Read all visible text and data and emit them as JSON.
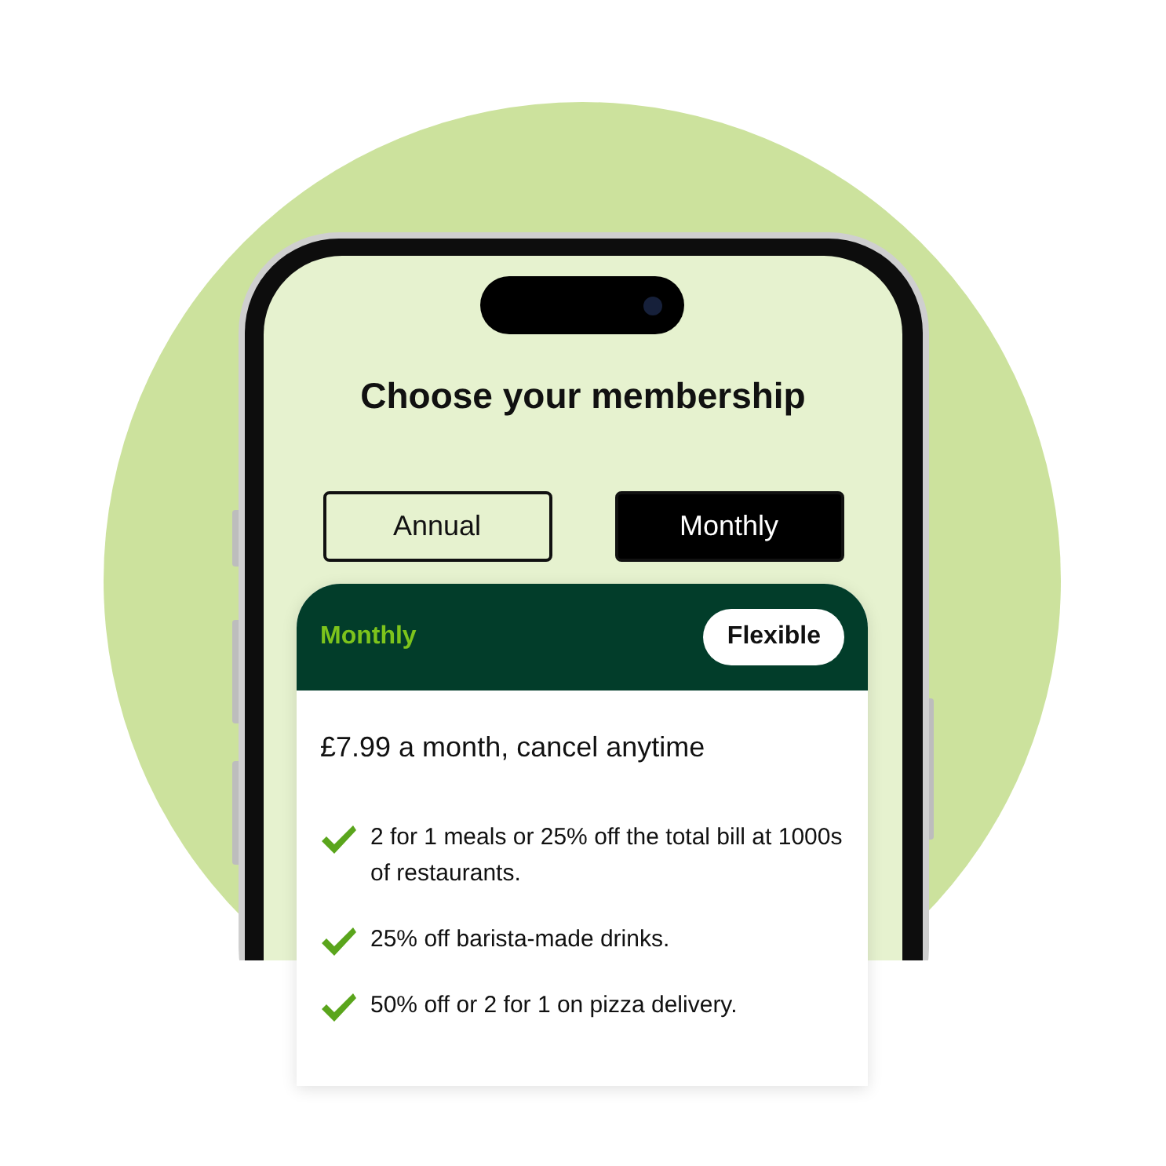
{
  "title": "Choose your membership",
  "plan_options": [
    {
      "label": "Annual",
      "selected": false
    },
    {
      "label": "Monthly",
      "selected": true
    }
  ],
  "plan_card": {
    "name": "Monthly",
    "badge": "Flexible",
    "price": "£7.99 a month, cancel anytime",
    "benefits": [
      {
        "text": "2 for 1 meals or 25% off the total bill at 1000s of restaurants."
      },
      {
        "text": "25% off barista-made drinks."
      },
      {
        "text": "50% off or 2 for 1 on pizza delivery."
      }
    ]
  }
}
